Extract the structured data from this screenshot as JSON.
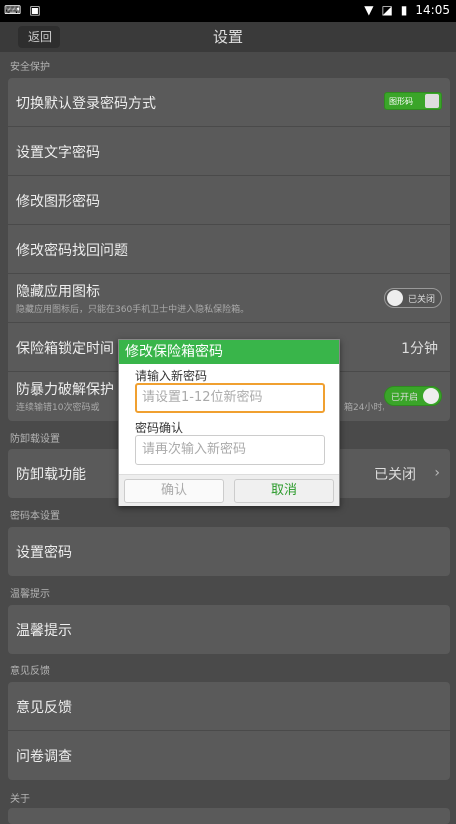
{
  "status_bar": {
    "time": "14:05"
  },
  "header": {
    "back_label": "返回",
    "title": "设置"
  },
  "sections": {
    "security": {
      "header": "安全保护",
      "switch_login": "切换默认登录密码方式",
      "pattern_toggle": "图形码",
      "set_text_pw": "设置文字密码",
      "modify_pattern": "修改图形密码",
      "modify_recovery": "修改密码找回问题",
      "hide_icon": "隐藏应用图标",
      "hide_icon_sub": "隐藏应用图标后，只能在360手机卫士中进入隐私保险箱。",
      "hide_icon_state": "已关闭",
      "lock_time": "保险箱锁定时间",
      "lock_time_value": "1分钟",
      "brute_force": "防暴力破解保护",
      "brute_force_sub": "连续输错10次密码或",
      "brute_force_sub_tail": "箱24小时。",
      "brute_force_state": "已开启"
    },
    "uninstall": {
      "header": "防卸载设置",
      "label": "防卸载功能",
      "value": "已关闭"
    },
    "pwbook": {
      "header": "密码本设置",
      "label": "设置密码"
    },
    "tips": {
      "header": "温馨提示",
      "label": "温馨提示"
    },
    "feedback": {
      "header": "意见反馈",
      "item1": "意见反馈",
      "item2": "问卷调查"
    },
    "about": {
      "header": "关于"
    }
  },
  "dialog": {
    "title": "修改保险箱密码",
    "new_label": "请输入新密码",
    "new_placeholder": "请设置1-12位新密码",
    "confirm_label": "密码确认",
    "confirm_placeholder": "请再次输入新密码",
    "ok": "确认",
    "cancel": "取消"
  }
}
